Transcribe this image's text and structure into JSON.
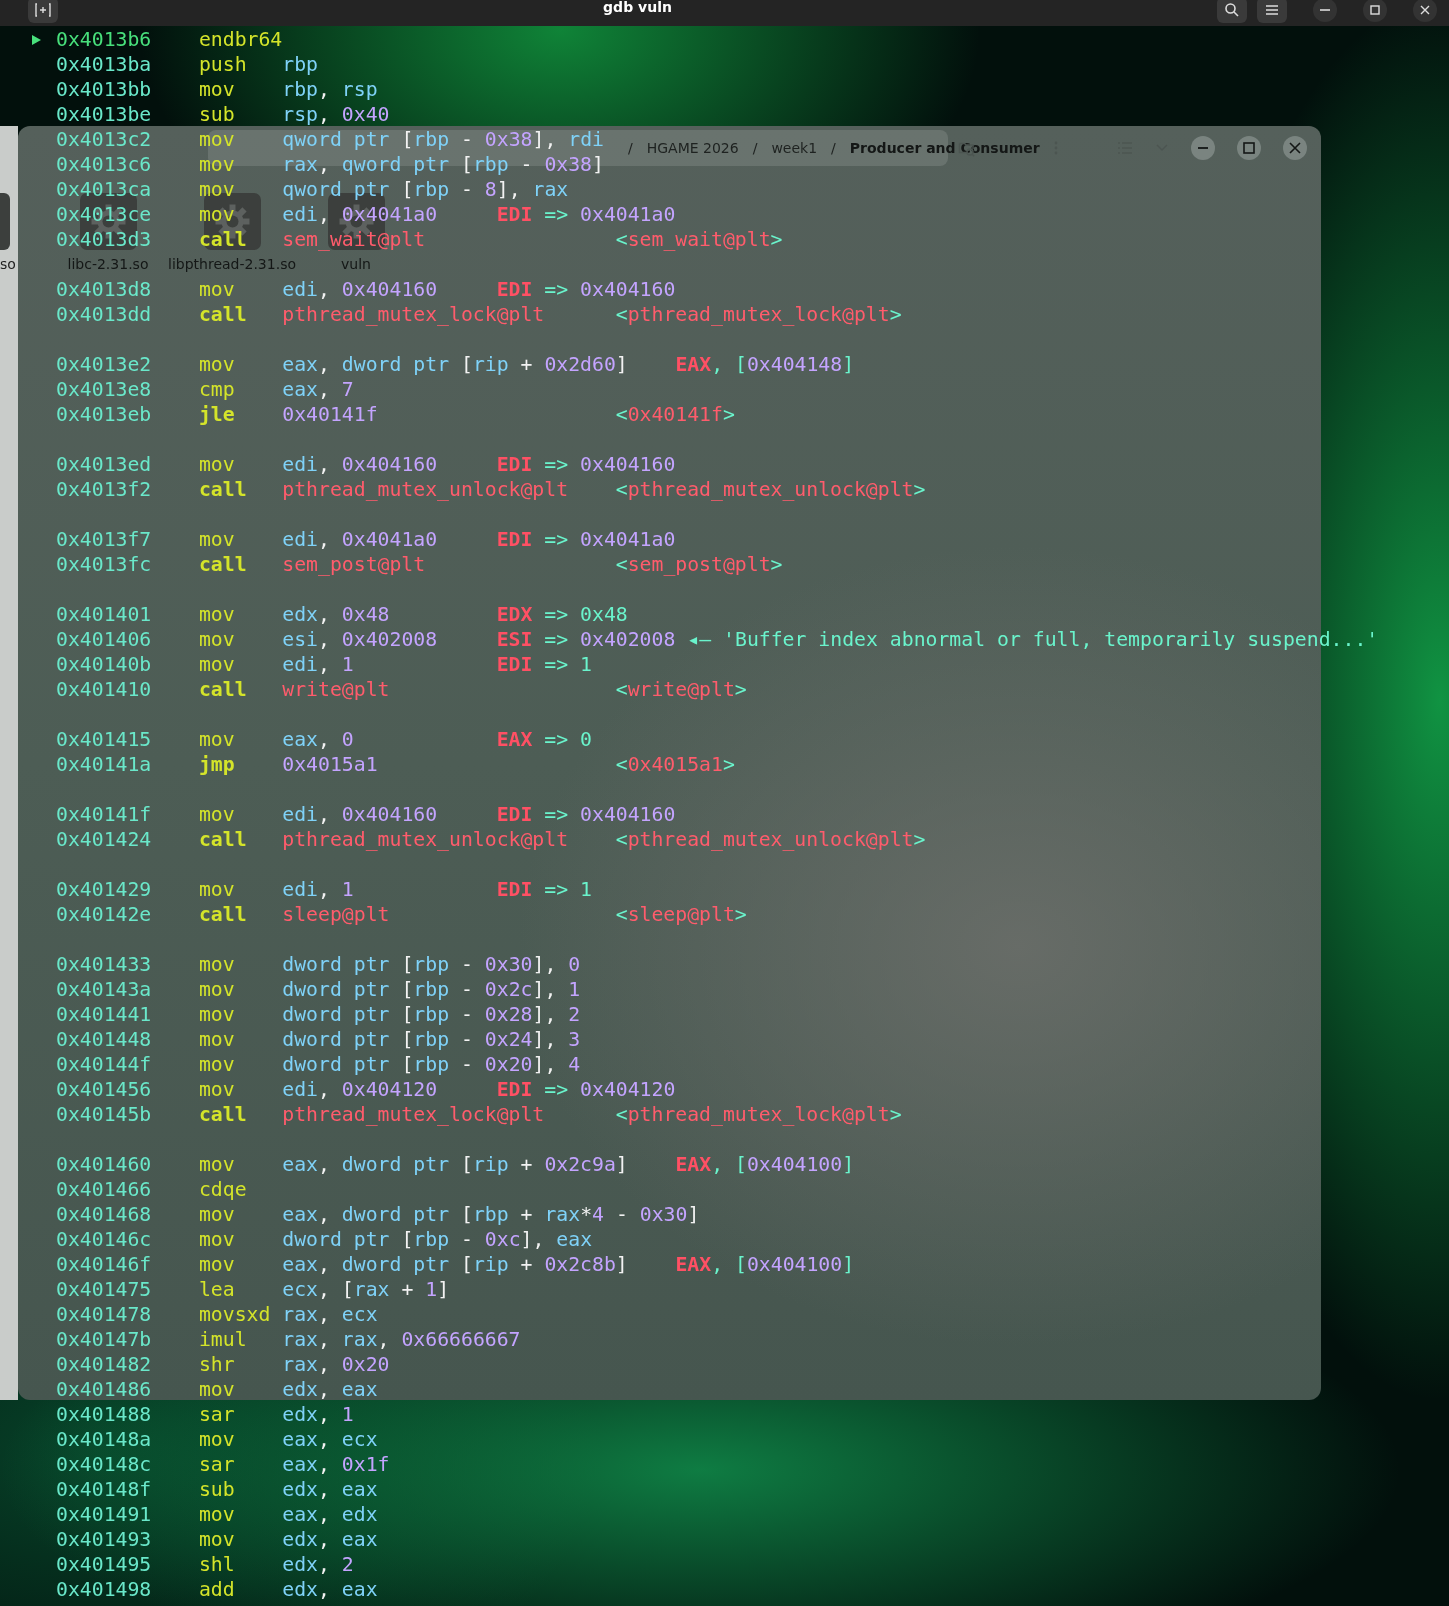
{
  "terminal": {
    "title": "gdb vuln"
  },
  "file_manager": {
    "edge_label": "so",
    "breadcrumb": [
      "/",
      "HGAME 2026",
      "/",
      "week1",
      "/",
      "Producer and Consumer"
    ],
    "files": [
      {
        "name": "libc-2.31.so"
      },
      {
        "name": "libpthread-2.31.so"
      },
      {
        "name": "vuln"
      }
    ]
  },
  "disassembly": {
    "blocks": [
      [
        {
          "address": "0x4013b6",
          "mnemonic": "endbr64",
          "current": true,
          "bold": false
        },
        {
          "address": "0x4013ba",
          "mnemonic": "push",
          "operands": "rbp",
          "current": false,
          "bold": false
        },
        {
          "address": "0x4013bb",
          "mnemonic": "mov",
          "operands": "rbp, rsp",
          "current": false,
          "bold": false
        },
        {
          "address": "0x4013be",
          "mnemonic": "sub",
          "operands": "rsp, 0x40",
          "current": false,
          "bold": false
        },
        {
          "address": "0x4013c2",
          "mnemonic": "mov",
          "operands": "qword ptr [rbp - 0x38], rdi",
          "current": false,
          "bold": false
        },
        {
          "address": "0x4013c6",
          "mnemonic": "mov",
          "operands": "rax, qword ptr [rbp - 0x38]",
          "current": false,
          "bold": false
        },
        {
          "address": "0x4013ca",
          "mnemonic": "mov",
          "operands": "qword ptr [rbp - 8], rax",
          "current": false,
          "bold": false
        },
        {
          "address": "0x4013ce",
          "mnemonic": "mov",
          "operands": "edi, 0x4041a0",
          "note": "EDI => 0x4041a0",
          "current": false,
          "bold": false
        },
        {
          "address": "0x4013d3",
          "mnemonic": "call",
          "operands": "sem_wait@plt",
          "target": "<sem_wait@plt>",
          "current": false,
          "bold": true
        }
      ],
      [
        {
          "address": "0x4013d8",
          "mnemonic": "mov",
          "operands": "edi, 0x404160",
          "note": "EDI => 0x404160",
          "current": false,
          "bold": false
        },
        {
          "address": "0x4013dd",
          "mnemonic": "call",
          "operands": "pthread_mutex_lock@plt",
          "target": "<pthread_mutex_lock@plt>",
          "current": false,
          "bold": true
        }
      ],
      [
        {
          "address": "0x4013e2",
          "mnemonic": "mov",
          "operands": "eax, dword ptr [rip + 0x2d60]",
          "note": "EAX, [0x404148]",
          "current": false,
          "bold": false
        },
        {
          "address": "0x4013e8",
          "mnemonic": "cmp",
          "operands": "eax, 7",
          "current": false,
          "bold": false
        },
        {
          "address": "0x4013eb",
          "mnemonic": "jle",
          "operands": "0x40141f",
          "target": "<0x40141f>",
          "current": false,
          "bold": true
        }
      ],
      [
        {
          "address": "0x4013ed",
          "mnemonic": "mov",
          "operands": "edi, 0x404160",
          "note": "EDI => 0x404160",
          "current": false,
          "bold": false
        },
        {
          "address": "0x4013f2",
          "mnemonic": "call",
          "operands": "pthread_mutex_unlock@plt",
          "target": "<pthread_mutex_unlock@plt>",
          "current": false,
          "bold": true
        }
      ],
      [
        {
          "address": "0x4013f7",
          "mnemonic": "mov",
          "operands": "edi, 0x4041a0",
          "note": "EDI => 0x4041a0",
          "current": false,
          "bold": false
        },
        {
          "address": "0x4013fc",
          "mnemonic": "call",
          "operands": "sem_post@plt",
          "target": "<sem_post@plt>",
          "current": false,
          "bold": true
        }
      ],
      [
        {
          "address": "0x401401",
          "mnemonic": "mov",
          "operands": "edx, 0x48",
          "note": "EDX => 0x48",
          "current": false,
          "bold": false
        },
        {
          "address": "0x401406",
          "mnemonic": "mov",
          "operands": "esi, 0x402008",
          "note": "ESI => 0x402008 ◂— 'Buffer index abnormal or full, temporarily suspend...'",
          "current": false,
          "bold": false
        },
        {
          "address": "0x40140b",
          "mnemonic": "mov",
          "operands": "edi, 1",
          "note": "EDI => 1",
          "current": false,
          "bold": false
        },
        {
          "address": "0x401410",
          "mnemonic": "call",
          "operands": "write@plt",
          "target": "<write@plt>",
          "current": false,
          "bold": true
        }
      ],
      [
        {
          "address": "0x401415",
          "mnemonic": "mov",
          "operands": "eax, 0",
          "note": "EAX => 0",
          "current": false,
          "bold": false
        },
        {
          "address": "0x40141a",
          "mnemonic": "jmp",
          "operands": "0x4015a1",
          "target": "<0x4015a1>",
          "current": false,
          "bold": true
        }
      ],
      [
        {
          "address": "0x40141f",
          "mnemonic": "mov",
          "operands": "edi, 0x404160",
          "note": "EDI => 0x404160",
          "current": false,
          "bold": false
        },
        {
          "address": "0x401424",
          "mnemonic": "call",
          "operands": "pthread_mutex_unlock@plt",
          "target": "<pthread_mutex_unlock@plt>",
          "current": false,
          "bold": true
        }
      ],
      [
        {
          "address": "0x401429",
          "mnemonic": "mov",
          "operands": "edi, 1",
          "note": "EDI => 1",
          "current": false,
          "bold": false
        },
        {
          "address": "0x40142e",
          "mnemonic": "call",
          "operands": "sleep@plt",
          "target": "<sleep@plt>",
          "current": false,
          "bold": true
        }
      ],
      [
        {
          "address": "0x401433",
          "mnemonic": "mov",
          "operands": "dword ptr [rbp - 0x30], 0",
          "current": false,
          "bold": false
        },
        {
          "address": "0x40143a",
          "mnemonic": "mov",
          "operands": "dword ptr [rbp - 0x2c], 1",
          "current": false,
          "bold": false
        },
        {
          "address": "0x401441",
          "mnemonic": "mov",
          "operands": "dword ptr [rbp - 0x28], 2",
          "current": false,
          "bold": false
        },
        {
          "address": "0x401448",
          "mnemonic": "mov",
          "operands": "dword ptr [rbp - 0x24], 3",
          "current": false,
          "bold": false
        },
        {
          "address": "0x40144f",
          "mnemonic": "mov",
          "operands": "dword ptr [rbp - 0x20], 4",
          "current": false,
          "bold": false
        },
        {
          "address": "0x401456",
          "mnemonic": "mov",
          "operands": "edi, 0x404120",
          "note": "EDI => 0x404120",
          "current": false,
          "bold": false
        },
        {
          "address": "0x40145b",
          "mnemonic": "call",
          "operands": "pthread_mutex_lock@plt",
          "target": "<pthread_mutex_lock@plt>",
          "current": false,
          "bold": true
        }
      ],
      [
        {
          "address": "0x401460",
          "mnemonic": "mov",
          "operands": "eax, dword ptr [rip + 0x2c9a]",
          "note": "EAX, [0x404100]",
          "current": false,
          "bold": false
        },
        {
          "address": "0x401466",
          "mnemonic": "cdqe",
          "current": false,
          "bold": false
        },
        {
          "address": "0x401468",
          "mnemonic": "mov",
          "operands": "eax, dword ptr [rbp + rax*4 - 0x30]",
          "current": false,
          "bold": false
        },
        {
          "address": "0x40146c",
          "mnemonic": "mov",
          "operands": "dword ptr [rbp - 0xc], eax",
          "current": false,
          "bold": false
        },
        {
          "address": "0x40146f",
          "mnemonic": "mov",
          "operands": "eax, dword ptr [rip + 0x2c8b]",
          "note": "EAX, [0x404100]",
          "current": false,
          "bold": false
        },
        {
          "address": "0x401475",
          "mnemonic": "lea",
          "operands": "ecx, [rax + 1]",
          "current": false,
          "bold": false
        },
        {
          "address": "0x401478",
          "mnemonic": "movsxd",
          "operands": "rax, ecx",
          "current": false,
          "bold": false
        },
        {
          "address": "0x40147b",
          "mnemonic": "imul",
          "operands": "rax, rax, 0x66666667",
          "current": false,
          "bold": false
        },
        {
          "address": "0x401482",
          "mnemonic": "shr",
          "operands": "rax, 0x20",
          "current": false,
          "bold": false
        },
        {
          "address": "0x401486",
          "mnemonic": "mov",
          "operands": "edx, eax",
          "current": false,
          "bold": false
        },
        {
          "address": "0x401488",
          "mnemonic": "sar",
          "operands": "edx, 1",
          "current": false,
          "bold": false
        },
        {
          "address": "0x40148a",
          "mnemonic": "mov",
          "operands": "eax, ecx",
          "current": false,
          "bold": false
        },
        {
          "address": "0x40148c",
          "mnemonic": "sar",
          "operands": "eax, 0x1f",
          "current": false,
          "bold": false
        },
        {
          "address": "0x40148f",
          "mnemonic": "sub",
          "operands": "edx, eax",
          "current": false,
          "bold": false
        },
        {
          "address": "0x401491",
          "mnemonic": "mov",
          "operands": "eax, edx",
          "current": false,
          "bold": false
        },
        {
          "address": "0x401493",
          "mnemonic": "mov",
          "operands": "edx, eax",
          "current": false,
          "bold": false
        },
        {
          "address": "0x401495",
          "mnemonic": "shl",
          "operands": "edx, 2",
          "current": false,
          "bold": false
        },
        {
          "address": "0x401498",
          "mnemonic": "add",
          "operands": "edx, eax",
          "current": false,
          "bold": false
        }
      ]
    ]
  }
}
